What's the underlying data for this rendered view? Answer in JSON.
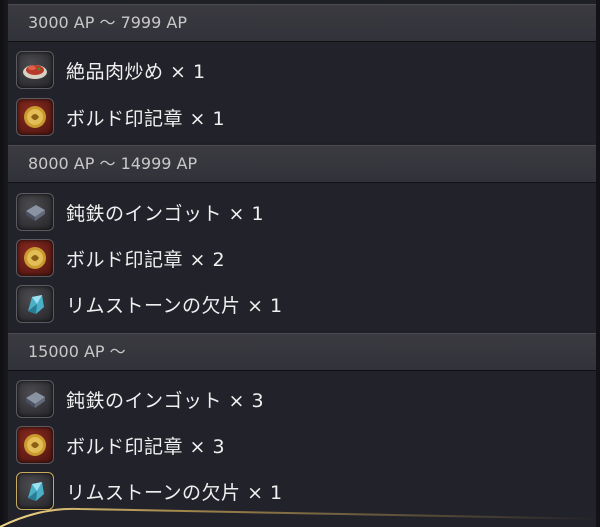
{
  "sections": [
    {
      "header": "3000 AP ～ 7999 AP",
      "items": [
        {
          "icon": "meat-dish-icon",
          "label": "絶品肉炒め × 1"
        },
        {
          "icon": "bold-seal-icon",
          "label": "ボルド印記章 × 1"
        }
      ]
    },
    {
      "header": "8000 AP ～ 14999 AP",
      "items": [
        {
          "icon": "iron-ingot-icon",
          "label": "鈍鉄のインゴット × 1"
        },
        {
          "icon": "bold-seal-icon",
          "label": "ボルド印記章 × 2"
        },
        {
          "icon": "rimstone-shard-icon",
          "label": "リムストーンの欠片 × 1"
        }
      ]
    },
    {
      "header": "15000 AP ～",
      "items": [
        {
          "icon": "iron-ingot-icon",
          "label": "鈍鉄のインゴット × 3"
        },
        {
          "icon": "bold-seal-icon",
          "label": "ボルド印記章 × 3"
        },
        {
          "icon": "rimstone-shard-icon",
          "label": "リムストーンの欠片 × 1"
        }
      ]
    }
  ],
  "colors": {
    "header_bg": "#35353c",
    "body_bg": "#22222a",
    "text": "#f0f0f0",
    "header_text": "#c8c8c8",
    "gold_accent": "#d8b25a"
  }
}
